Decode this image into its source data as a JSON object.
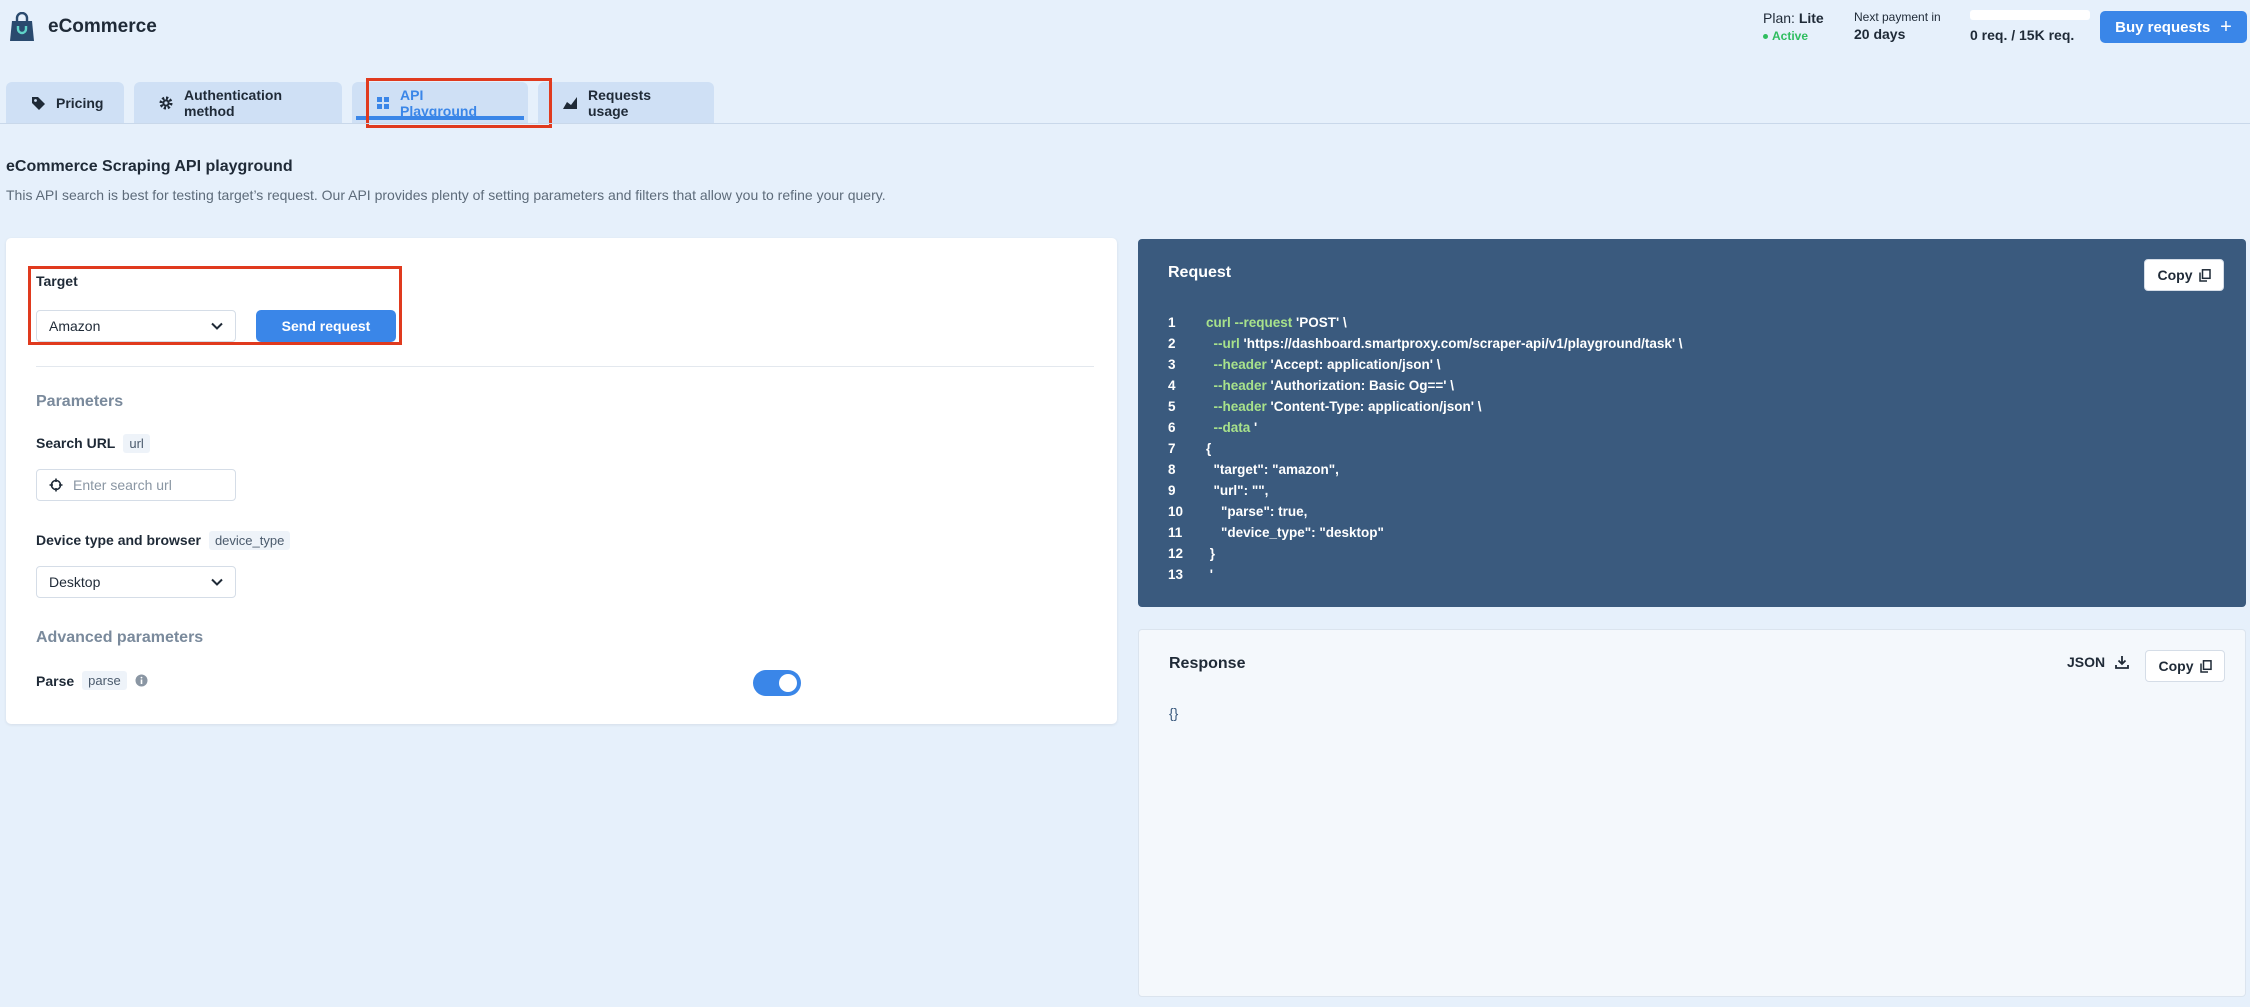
{
  "app": {
    "title": "eCommerce"
  },
  "header": {
    "plan_label": "Plan:",
    "plan_value": "Lite",
    "status": "Active",
    "next_payment_label": "Next payment in",
    "next_payment_value": "20 days",
    "usage_text": "0 req. / 15K req.",
    "usage_fraction": 0,
    "buy_label": "Buy requests",
    "buy_icon": "plus-icon"
  },
  "tabs": [
    {
      "label": "Pricing",
      "icon": "tag-icon"
    },
    {
      "label": "Authentication method",
      "icon": "gear-icon"
    },
    {
      "label": "API Playground",
      "icon": "grid-icon",
      "active": true
    },
    {
      "label": "Requests usage",
      "icon": "chart-icon"
    }
  ],
  "intro": {
    "title": "eCommerce Scraping API playground",
    "description": "This API search is best for testing target’s request. Our API provides plenty of setting parameters and filters that allow you to refine your query."
  },
  "form": {
    "target_label": "Target",
    "target_value": "Amazon",
    "send_label": "Send request",
    "parameters_heading": "Parameters",
    "search_url_label": "Search URL",
    "search_url_tag": "url",
    "search_url_placeholder": "Enter search url",
    "device_label": "Device type and browser",
    "device_tag": "device_type",
    "device_value": "Desktop",
    "advanced_heading": "Advanced parameters",
    "parse_label": "Parse",
    "parse_tag": "parse",
    "parse_enabled": true
  },
  "request": {
    "title": "Request",
    "copy_label": "Copy",
    "lines": [
      {
        "n": "1",
        "indent": "",
        "kw": "curl --request",
        "rest": " 'POST' \\"
      },
      {
        "n": "2",
        "indent": "  ",
        "kw": "--url",
        "rest": " 'https://dashboard.smartproxy.com/scraper-api/v1/playground/task' \\"
      },
      {
        "n": "3",
        "indent": "  ",
        "kw": "--header",
        "rest": " 'Accept: application/json' \\"
      },
      {
        "n": "4",
        "indent": "  ",
        "kw": "--header",
        "rest": " 'Authorization: Basic Og==' \\"
      },
      {
        "n": "5",
        "indent": "  ",
        "kw": "--header",
        "rest": " 'Content-Type: application/json' \\"
      },
      {
        "n": "6",
        "indent": "  ",
        "kw": "--data",
        "rest": " '"
      },
      {
        "n": "7",
        "indent": "",
        "kw": "",
        "rest": "{"
      },
      {
        "n": "8",
        "indent": "  ",
        "kw": "",
        "rest": "\"target\": \"amazon\","
      },
      {
        "n": "9",
        "indent": "  ",
        "kw": "",
        "rest": "\"url\": \"\","
      },
      {
        "n": "10",
        "indent": "    ",
        "kw": "",
        "rest": "\"parse\": true,"
      },
      {
        "n": "11",
        "indent": "    ",
        "kw": "",
        "rest": "\"device_type\": \"desktop\""
      },
      {
        "n": "12",
        "indent": " ",
        "kw": "",
        "rest": "}"
      },
      {
        "n": "13",
        "indent": " ",
        "kw": "",
        "rest": "'"
      }
    ]
  },
  "response": {
    "title": "Response",
    "json_label": "JSON",
    "copy_label": "Copy",
    "body": "{}"
  },
  "colors": {
    "accent": "#3a86e8",
    "active_status": "#2fbd5f",
    "request_bg": "#3a5a7e",
    "code_keyword": "#a8e28b",
    "highlight_box": "#e03a1e"
  }
}
